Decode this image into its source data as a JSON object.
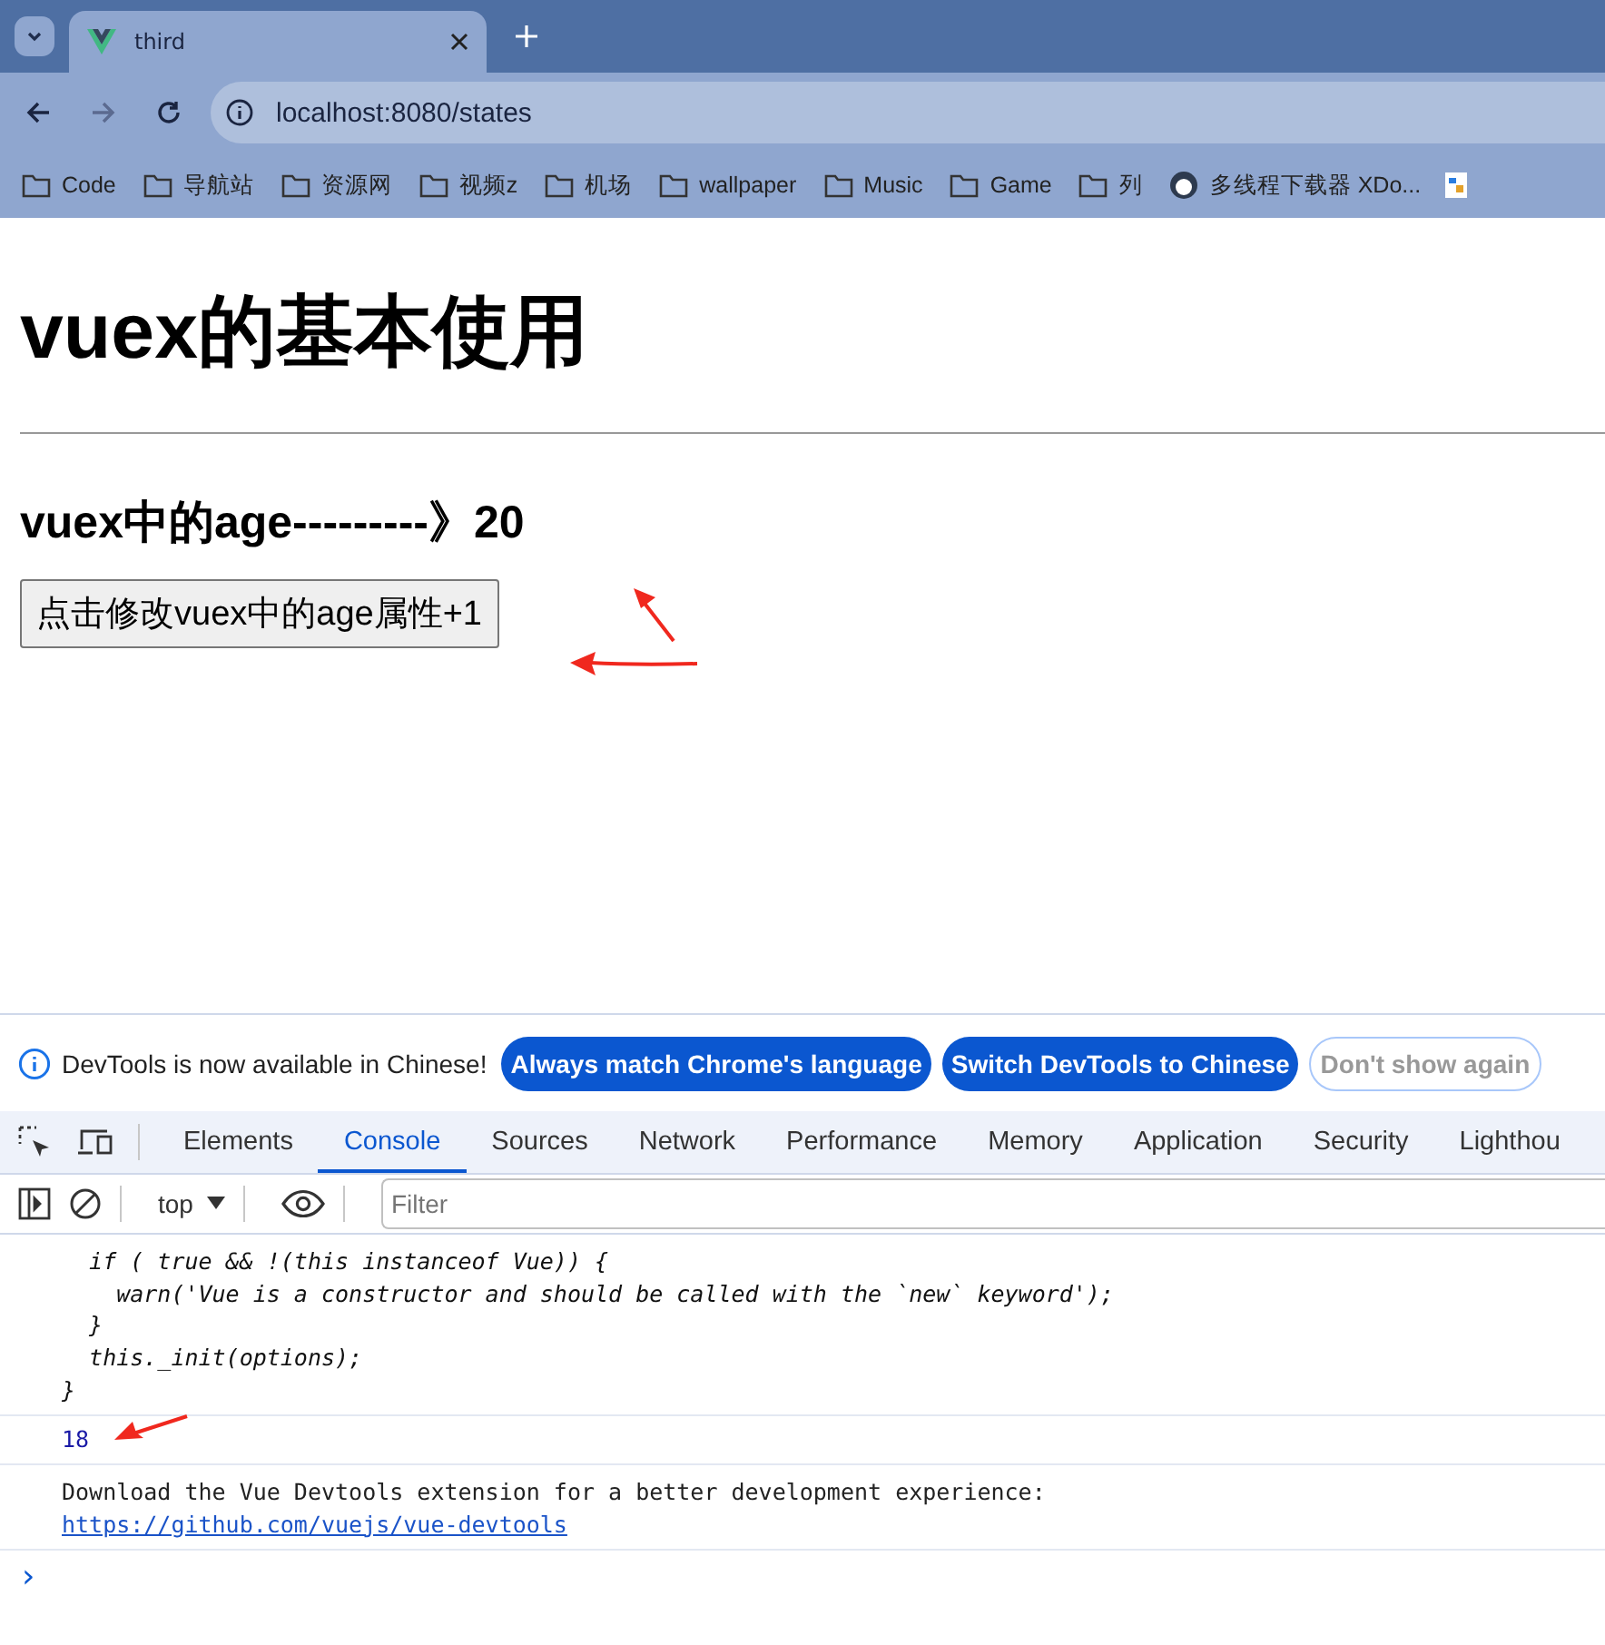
{
  "browser": {
    "tabs": [
      {
        "title": "third",
        "selected": true
      }
    ],
    "address": "localhost:8080/states",
    "bookmarks": [
      {
        "label": "Code",
        "kind": "folder"
      },
      {
        "label": "导航站",
        "kind": "folder"
      },
      {
        "label": "资源网",
        "kind": "folder"
      },
      {
        "label": "视频z",
        "kind": "folder"
      },
      {
        "label": "机场",
        "kind": "folder"
      },
      {
        "label": "wallpaper",
        "kind": "folder"
      },
      {
        "label": "Music",
        "kind": "folder"
      },
      {
        "label": "Game",
        "kind": "folder"
      },
      {
        "label": "列",
        "kind": "folder"
      },
      {
        "label": "多线程下载器 XDo...",
        "kind": "site"
      }
    ]
  },
  "page": {
    "title": "vuex的基本使用",
    "age_line": "vuex中的age---------》20",
    "button": "点击修改vuex中的age属性+1"
  },
  "devtools": {
    "infobar": {
      "message": "DevTools is now available in Chinese!",
      "buttons": [
        {
          "label": "Always match Chrome's language",
          "kind": "primary"
        },
        {
          "label": "Switch DevTools to Chinese",
          "kind": "primary"
        },
        {
          "label": "Don't show again",
          "kind": "outline"
        }
      ]
    },
    "tabs": [
      {
        "label": "Elements",
        "selected": false
      },
      {
        "label": "Console",
        "selected": true
      },
      {
        "label": "Sources",
        "selected": false
      },
      {
        "label": "Network",
        "selected": false
      },
      {
        "label": "Performance",
        "selected": false
      },
      {
        "label": "Memory",
        "selected": false
      },
      {
        "label": "Application",
        "selected": false
      },
      {
        "label": "Security",
        "selected": false
      },
      {
        "label": "Lighthou",
        "selected": false
      }
    ],
    "context": "top",
    "filter_placeholder": "Filter",
    "console": [
      {
        "kind": "code",
        "lines": [
          "  if ( true && !(this instanceof Vue)) {",
          "    warn('Vue is a constructor and should be called with the `new` keyword');",
          "  }",
          "  this._init(options);",
          "}"
        ]
      },
      {
        "kind": "number",
        "text": "18"
      },
      {
        "kind": "message",
        "text": "Download the Vue Devtools extension for a better development experience:",
        "link": "https://github.com/vuejs/vue-devtools"
      }
    ],
    "prompt": "›"
  }
}
